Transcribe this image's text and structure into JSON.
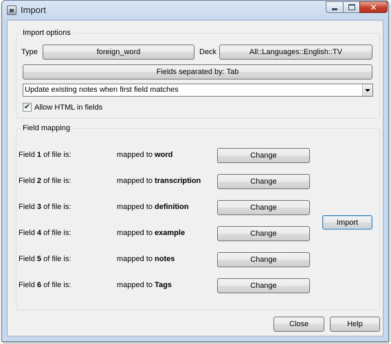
{
  "window": {
    "title": "Import",
    "controls": {
      "minimize_icon": "minimize-icon",
      "maximize_icon": "maximize-icon",
      "close_glyph": "✕"
    }
  },
  "import_options": {
    "group_title": "Import options",
    "type_label": "Type",
    "type_value": "foreign_word",
    "deck_label": "Deck",
    "deck_value": "All::Languages::English::TV",
    "separator_button": "Fields separated by: Tab",
    "update_mode": "Update existing notes when first field matches",
    "allow_html_label": "Allow HTML in fields",
    "allow_html_checked": true,
    "check_glyph": "✔"
  },
  "field_mapping": {
    "group_title": "Field mapping",
    "rows": [
      {
        "prefix": "Field ",
        "num": "1",
        "suffix": " of file is:",
        "mapped_prefix": "mapped to ",
        "target": "word",
        "button": "Change"
      },
      {
        "prefix": "Field ",
        "num": "2",
        "suffix": " of file is:",
        "mapped_prefix": "mapped to ",
        "target": "transcription",
        "button": "Change"
      },
      {
        "prefix": "Field ",
        "num": "3",
        "suffix": " of file is:",
        "mapped_prefix": "mapped to ",
        "target": "definition",
        "button": "Change"
      },
      {
        "prefix": "Field ",
        "num": "4",
        "suffix": " of file is:",
        "mapped_prefix": "mapped to ",
        "target": "example",
        "button": "Change"
      },
      {
        "prefix": "Field ",
        "num": "5",
        "suffix": " of file is:",
        "mapped_prefix": "mapped to ",
        "target": "notes",
        "button": "Change"
      },
      {
        "prefix": "Field ",
        "num": "6",
        "suffix": " of file is:",
        "mapped_prefix": "mapped to ",
        "target": "Tags",
        "button": "Change"
      }
    ],
    "import_button": "Import"
  },
  "footer": {
    "close_button": "Close",
    "help_button": "Help"
  }
}
